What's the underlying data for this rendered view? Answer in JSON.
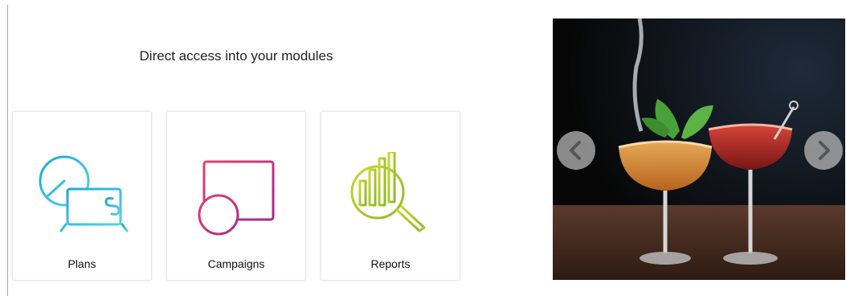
{
  "heading": "Direct access into your modules",
  "modules": [
    {
      "label": "Plans",
      "icon": "pie-chart-laptop-icon",
      "colors": [
        "#1aa8d8",
        "#5ad1e8"
      ]
    },
    {
      "label": "Campaigns",
      "icon": "calendar-clock-icon",
      "colors": [
        "#e4406f",
        "#a8288a"
      ]
    },
    {
      "label": "Reports",
      "icon": "bar-chart-magnifier-icon",
      "colors": [
        "#c9d630",
        "#8fb82a"
      ]
    }
  ],
  "carousel": {
    "image": "cocktail-glasses-photo",
    "prev_icon": "chevron-left-icon",
    "next_icon": "chevron-right-icon"
  }
}
